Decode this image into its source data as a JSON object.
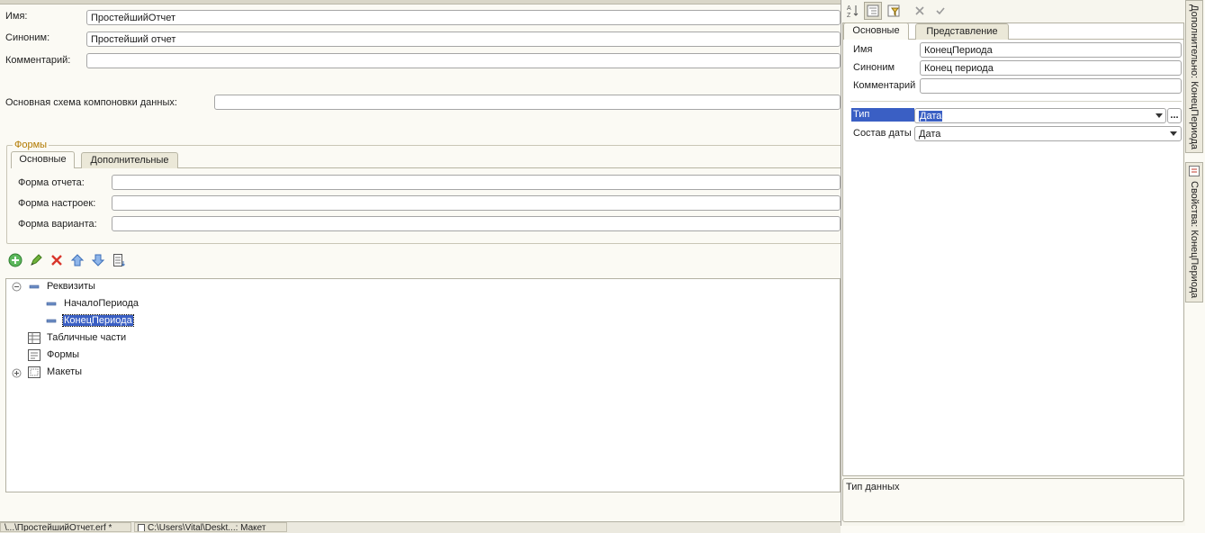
{
  "main": {
    "name_label": "Имя:",
    "name_value": "ПростейшийОтчет",
    "synonym_label": "Синоним:",
    "synonym_value": "Простейший отчет",
    "comment_label": "Комментарий:",
    "comment_value": "",
    "schema_label": "Основная схема компоновки данных:",
    "schema_value": ""
  },
  "forms": {
    "group_title": "Формы",
    "tabs": [
      {
        "label": "Основные"
      },
      {
        "label": "Дополнительные"
      }
    ],
    "report_form_label": "Форма отчета:",
    "settings_form_label": "Форма настроек:",
    "variant_form_label": "Форма варианта:"
  },
  "toolbar": {
    "icons": [
      "add-icon",
      "edit-icon",
      "delete-icon",
      "move-up-icon",
      "move-down-icon",
      "sort-list-icon"
    ]
  },
  "tree": {
    "items": [
      {
        "label": "Реквизиты"
      },
      {
        "label": "НачалоПериода"
      },
      {
        "label": "КонецПериода"
      },
      {
        "label": "Табличные части"
      },
      {
        "label": "Формы"
      },
      {
        "label": "Макеты"
      }
    ]
  },
  "props": {
    "tabs": [
      {
        "label": "Основные"
      },
      {
        "label": "Представление"
      }
    ],
    "name_label": "Имя",
    "name_value": "КонецПериода",
    "synonym_label": "Синоним",
    "synonym_value": "Конец периода",
    "comment_label": "Комментарий",
    "comment_value": "",
    "type_label": "Тип",
    "type_value": "Дата",
    "date_comp_label": "Состав даты",
    "date_comp_value": "Дата",
    "ellipsis": "...",
    "description": "Тип данных"
  },
  "side_tabs": {
    "extra": "Дополнительно: КонецПериода",
    "properties": "Свойства: КонецПериода"
  },
  "taskbar": {
    "items": [
      {
        "label": "\\...\\ПростейшийОтчет.erf *"
      },
      {
        "label": "C:\\Users\\Vital\\Deskt...: Макет"
      }
    ]
  },
  "colors": {
    "selection": "#3a5fc4",
    "group_title": "#b27a00"
  }
}
